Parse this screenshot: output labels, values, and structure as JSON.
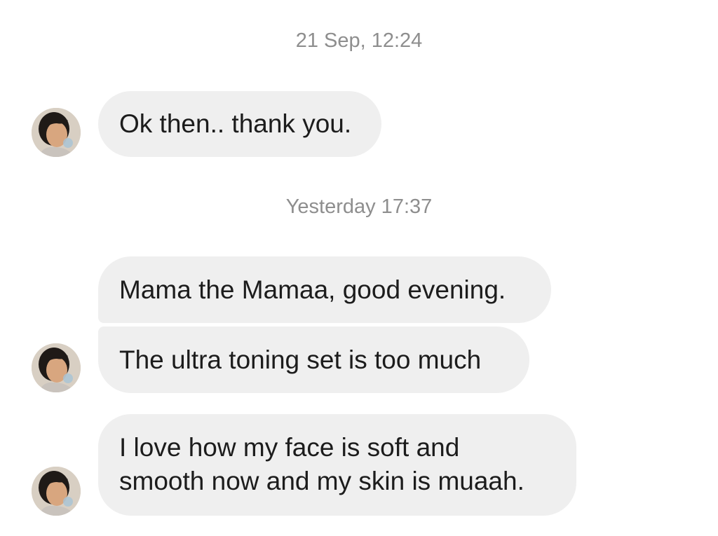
{
  "conversation": {
    "timestamps": [
      "21 Sep, 12:24",
      "Yesterday 17:37"
    ],
    "messages": [
      {
        "text": "Ok then.. thank you."
      },
      {
        "text": "Mama the Mamaa, good evening."
      },
      {
        "text": "The ultra toning set is too much"
      },
      {
        "lines": [
          "I love how my face is soft and",
          "smooth now and my skin is muaah."
        ]
      }
    ],
    "avatar_icon": "contact-avatar-photo",
    "bubble_color": "#efefef",
    "timestamp_color": "#8e8e8e"
  }
}
